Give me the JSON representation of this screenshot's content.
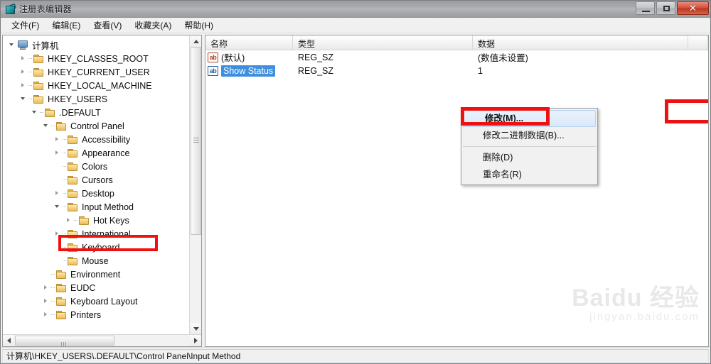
{
  "window": {
    "title": "注册表编辑器",
    "icon": "registry-editor-icon",
    "controls": {
      "minimize": "–",
      "maximize": "□",
      "close": "✕"
    }
  },
  "menubar": {
    "items": [
      {
        "label": "文件(F)"
      },
      {
        "label": "编辑(E)"
      },
      {
        "label": "查看(V)"
      },
      {
        "label": "收藏夹(A)"
      },
      {
        "label": "帮助(H)"
      }
    ]
  },
  "tree": {
    "nodes": [
      {
        "label": "计算机",
        "indent": 0,
        "toggle": "expanded",
        "icon": "computer-icon",
        "dash": false
      },
      {
        "label": "HKEY_CLASSES_ROOT",
        "indent": 1,
        "toggle": "collapsed",
        "icon": "folder-icon",
        "dash": true
      },
      {
        "label": "HKEY_CURRENT_USER",
        "indent": 1,
        "toggle": "collapsed",
        "icon": "folder-icon",
        "dash": true
      },
      {
        "label": "HKEY_LOCAL_MACHINE",
        "indent": 1,
        "toggle": "collapsed",
        "icon": "folder-icon",
        "dash": true
      },
      {
        "label": "HKEY_USERS",
        "indent": 1,
        "toggle": "expanded",
        "icon": "folder-icon",
        "dash": true
      },
      {
        "label": ".DEFAULT",
        "indent": 2,
        "toggle": "expanded",
        "icon": "folder-icon",
        "dash": true
      },
      {
        "label": "Control Panel",
        "indent": 3,
        "toggle": "expanded",
        "icon": "folder-icon",
        "dash": true
      },
      {
        "label": "Accessibility",
        "indent": 4,
        "toggle": "collapsed",
        "icon": "folder-icon",
        "dash": true
      },
      {
        "label": "Appearance",
        "indent": 4,
        "toggle": "collapsed",
        "icon": "folder-icon",
        "dash": true
      },
      {
        "label": "Colors",
        "indent": 4,
        "toggle": "none",
        "icon": "folder-icon",
        "dash": true
      },
      {
        "label": "Cursors",
        "indent": 4,
        "toggle": "none",
        "icon": "folder-icon",
        "dash": true
      },
      {
        "label": "Desktop",
        "indent": 4,
        "toggle": "collapsed",
        "icon": "folder-icon",
        "dash": true
      },
      {
        "label": "Input Method",
        "indent": 4,
        "toggle": "expanded",
        "icon": "folder-icon",
        "dash": true,
        "highlighted": true
      },
      {
        "label": "Hot Keys",
        "indent": 5,
        "toggle": "collapsed",
        "icon": "folder-icon",
        "dash": true
      },
      {
        "label": "International",
        "indent": 4,
        "toggle": "collapsed",
        "icon": "folder-icon",
        "dash": true
      },
      {
        "label": "Keyboard",
        "indent": 4,
        "toggle": "none",
        "icon": "folder-icon",
        "dash": true
      },
      {
        "label": "Mouse",
        "indent": 4,
        "toggle": "none",
        "icon": "folder-icon",
        "dash": true
      },
      {
        "label": "Environment",
        "indent": 3,
        "toggle": "none",
        "icon": "folder-icon",
        "dash": true
      },
      {
        "label": "EUDC",
        "indent": 3,
        "toggle": "collapsed",
        "icon": "folder-icon",
        "dash": true
      },
      {
        "label": "Keyboard Layout",
        "indent": 3,
        "toggle": "collapsed",
        "icon": "folder-icon",
        "dash": true
      },
      {
        "label": "Printers",
        "indent": 3,
        "toggle": "collapsed",
        "icon": "folder-icon",
        "dash": true
      }
    ]
  },
  "list": {
    "columns": [
      {
        "label": "名称"
      },
      {
        "label": "类型"
      },
      {
        "label": "数据"
      }
    ],
    "rows": [
      {
        "name": "(默认)",
        "type": "REG_SZ",
        "data": "(数值未设置)",
        "selected": false
      },
      {
        "name": "Show Status",
        "type": "REG_SZ",
        "data": "1",
        "selected": true
      }
    ]
  },
  "context_menu": {
    "items": [
      {
        "label": "修改(M)...",
        "highlighted": true,
        "separator_after": false
      },
      {
        "label": "修改二进制数据(B)...",
        "highlighted": false,
        "separator_after": true
      },
      {
        "label": "删除(D)",
        "highlighted": false,
        "separator_after": false
      },
      {
        "label": "重命名(R)",
        "highlighted": false,
        "separator_after": false
      }
    ]
  },
  "statusbar": {
    "path": "计算机\\HKEY_USERS\\.DEFAULT\\Control Panel\\Input Method"
  },
  "watermark": {
    "main": "Baidu 经验",
    "sub": "jingyan.baidu.com"
  },
  "annotations": {
    "highlight_color": "#ee1111",
    "boxes": [
      {
        "target": "tree-item-input-method"
      },
      {
        "target": "context-menu-item-modify"
      },
      {
        "target": "list-data-value-1"
      }
    ]
  }
}
